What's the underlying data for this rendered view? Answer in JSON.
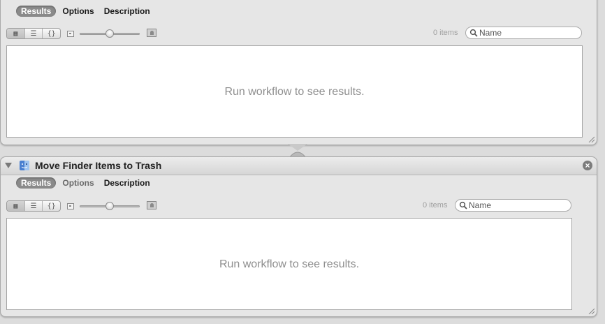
{
  "panel1": {
    "tabs": [
      {
        "label": "Results",
        "selected": true
      },
      {
        "label": "Options",
        "selected": false
      },
      {
        "label": "Description",
        "selected": false
      }
    ],
    "item_count": "0 items",
    "search_placeholder": "Name",
    "results_message": "Run workflow to see results."
  },
  "panel2": {
    "title": "Move Finder Items to Trash",
    "tabs": [
      {
        "label": "Results",
        "selected": true
      },
      {
        "label": "Options",
        "selected": false
      },
      {
        "label": "Description",
        "selected": false
      }
    ],
    "item_count": "0 items",
    "search_placeholder": "Name",
    "results_message": "Run workflow to see results."
  },
  "view_modes": [
    "icon-view-icon",
    "list-view-icon",
    "code-view-icon"
  ],
  "view_glyphs": {
    "icon": "▦",
    "list": "☰",
    "code": "{}"
  },
  "close_glyph": "×",
  "colors": {
    "panel_bg": "#e6e6e6",
    "selected_tab": "#8a8a8a",
    "hint_text": "#8e8e8e"
  }
}
